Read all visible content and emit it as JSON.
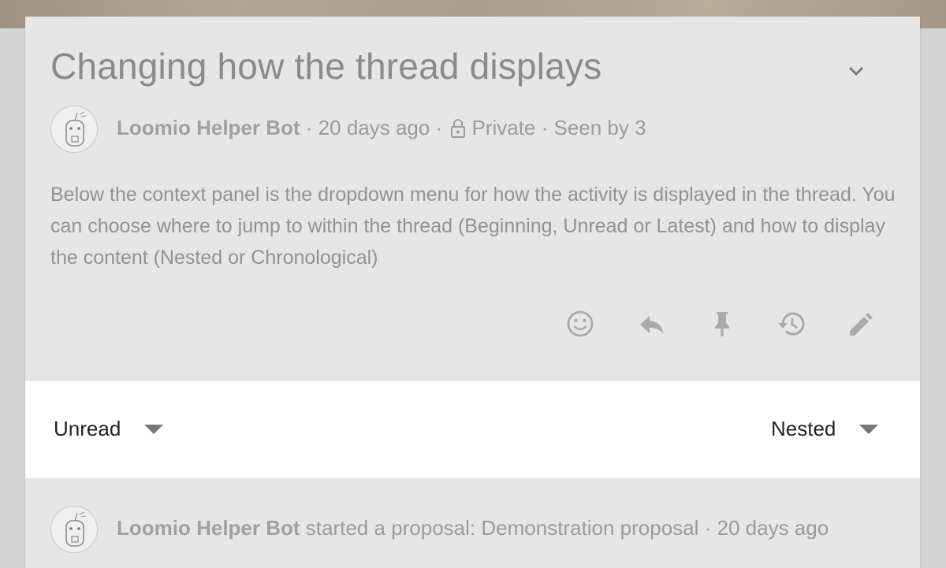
{
  "thread": {
    "title": "Changing how the thread displays",
    "author": "Loomio Helper Bot",
    "sep1": " · ",
    "time": "20 days ago",
    "sep2": " · ",
    "privacy": "Private",
    "sep3": " · ",
    "seen": "Seen by 3",
    "body": "Below the context panel is the dropdown menu for how the activity is displayed in the thread. You can choose where to jump to within the thread (Beginning, Unread or Latest) and how to display the content (Nested or Chronological)"
  },
  "actions": [
    "smiley-icon",
    "reply-icon",
    "pin-icon",
    "history-icon",
    "edit-icon"
  ],
  "filters": {
    "jump_to": "Unread",
    "display_mode": "Nested"
  },
  "event": {
    "author": "Loomio Helper Bot",
    "action": " started a proposal: Demonstration proposal",
    "sep": " · ",
    "time": "20 days ago"
  },
  "colors": {
    "card_bg": "#e6e6e6",
    "muted_text": "#9b9b9b",
    "filter_bg": "#ffffff"
  }
}
